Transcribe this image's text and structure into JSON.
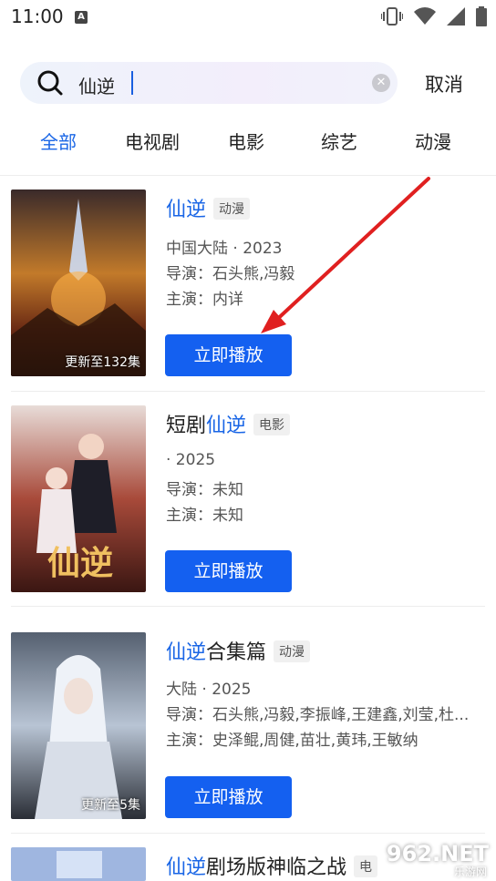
{
  "status": {
    "time": "11:00"
  },
  "search": {
    "query": "仙逆",
    "cancel_label": "取消"
  },
  "tabs": [
    {
      "label": "全部",
      "active": true
    },
    {
      "label": "电视剧",
      "active": false
    },
    {
      "label": "电影",
      "active": false
    },
    {
      "label": "综艺",
      "active": false
    },
    {
      "label": "动漫",
      "active": false
    }
  ],
  "results": [
    {
      "title_hl": "仙逆",
      "title_rest": "",
      "title_prefix": "",
      "tag": "动漫",
      "region_year": "中国大陆 · 2023",
      "director": "导演：石头熊,冯毅",
      "cast": "主演：内详",
      "badge": "更新至132集",
      "play_label": "立即播放"
    },
    {
      "title_prefix": "短剧",
      "title_hl": "仙逆",
      "title_rest": "",
      "tag": "电影",
      "region_year": " · 2025",
      "director": "导演：未知",
      "cast": "主演：未知",
      "badge": "",
      "play_label": "立即播放"
    },
    {
      "title_prefix": "",
      "title_hl": "仙逆",
      "title_rest": "合集篇",
      "tag": "动漫",
      "region_year": "大陆 · 2025",
      "director": "导演：石头熊,冯毅,李振峰,王建鑫,刘莹,杜...",
      "cast": "主演：史泽鲲,周健,苗壮,黄玮,王敏纳",
      "badge": "更新至5集",
      "play_label": "立即播放"
    },
    {
      "title_prefix": "",
      "title_hl": "仙逆",
      "title_rest": "剧场版神临之战",
      "tag": "电",
      "region_year": "",
      "director": "",
      "cast": "",
      "badge": "",
      "play_label": ""
    }
  ],
  "watermark": {
    "text": "962.NET",
    "sub": "乐游网"
  }
}
